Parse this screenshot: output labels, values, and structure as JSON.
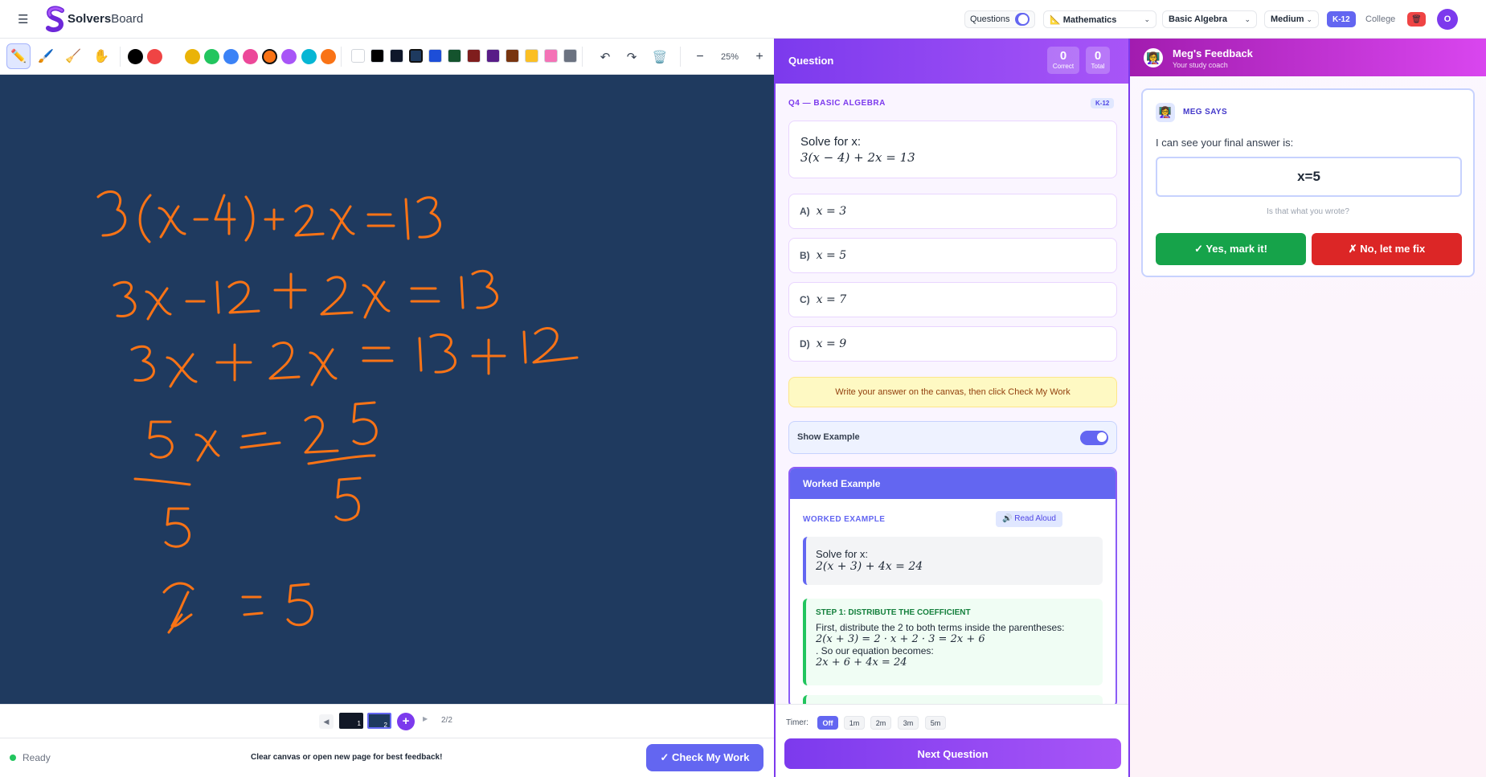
{
  "app": {
    "brand_bold": "Solvers",
    "brand_light": "Board",
    "menu_icon": "hamburger-icon"
  },
  "topbar": {
    "questions_label": "Questions",
    "subject": "📐 Mathematics",
    "topic": "Basic Algebra",
    "difficulty": "Medium",
    "level_options": [
      "K-12",
      "College"
    ],
    "active_level": "K-12",
    "user_initial": "O"
  },
  "toolbar": {
    "tools": [
      "pencil",
      "brush",
      "eraser",
      "hand"
    ],
    "active_tool": "pencil",
    "pen_colors": [
      "#000000",
      "#ef4444",
      "#eab308",
      "#22c55e",
      "#3b82f6",
      "#ec4899",
      "#f97316",
      "#a855f7",
      "#06b6d4",
      "#f97316"
    ],
    "bg_colors": [
      "#ffffff",
      "#000000",
      "#0f172a",
      "#1e3a5f",
      "#1d4ed8",
      "#14532d",
      "#7f1d1d",
      "#581c87",
      "#78350f",
      "#fbbf24",
      "#f472b6",
      "#6b7280"
    ],
    "zoom": "25%"
  },
  "canvas": {
    "background": "#1f3a5f",
    "ink_color": "#f97316",
    "handwritten_lines": [
      "3(x-4)+2x=13",
      "3x-12+2x=13",
      "3x+2x=13+12",
      "5x=25",
      "5  5",
      "x=5"
    ]
  },
  "pagenav": {
    "page_indicator": "2/2",
    "pages": [
      "1",
      "2"
    ]
  },
  "status": {
    "state": "Ready",
    "hint": "Clear canvas or open new page for best feedback!",
    "check_button": "✓ Check My Work"
  },
  "question_panel": {
    "title": "Question",
    "correct_count": "0",
    "correct_label": "Correct",
    "total_count": "0",
    "total_label": "Total",
    "question_id": "Q4 — BASIC ALGEBRA",
    "level_badge": "K-12",
    "prompt": "Solve for x:",
    "equation": "3(x − 4) + 2x = 13",
    "options": [
      {
        "letter": "A)",
        "value": "x = 3"
      },
      {
        "letter": "B)",
        "value": "x = 5"
      },
      {
        "letter": "C)",
        "value": "x = 7"
      },
      {
        "letter": "D)",
        "value": "x = 9"
      }
    ],
    "instruction": "Write your answer on the canvas, then click Check My Work",
    "show_example_label": "Show Example",
    "worked_example": {
      "header": "Worked Example",
      "section_label": "WORKED EXAMPLE",
      "read_aloud": "🔊 Read Aloud",
      "prompt": "Solve for x:",
      "equation": "2(x + 3) + 4x = 24",
      "step1_title": "STEP 1: DISTRIBUTE THE COEFFICIENT",
      "step1_text": "First, distribute the 2 to both terms inside the parentheses:",
      "step1_math": "2(x + 3) = 2 · x + 2 · 3 = 2x + 6",
      "step1_cont": ". So our equation becomes:",
      "step1_math2": "2x + 6 + 4x = 24"
    },
    "timer_label": "Timer:",
    "timer_options": [
      "Off",
      "1m",
      "2m",
      "3m",
      "5m"
    ],
    "timer_active": "Off",
    "next_button": "Next Question"
  },
  "feedback_panel": {
    "title": "Meg's Feedback",
    "subtitle": "Your study coach",
    "avatar_icon": "👩‍🏫",
    "says_label": "MEG SAYS",
    "intro": "I can see your final answer is:",
    "answer": "x=5",
    "question": "Is that what you wrote?",
    "yes_button": "✓ Yes, mark it!",
    "no_button": "✗ No, let me fix"
  },
  "colors": {
    "accent": "#7c3aed",
    "indigo": "#6366f1",
    "green": "#16a34a",
    "red": "#dc2626",
    "pink": "#d946ef"
  }
}
